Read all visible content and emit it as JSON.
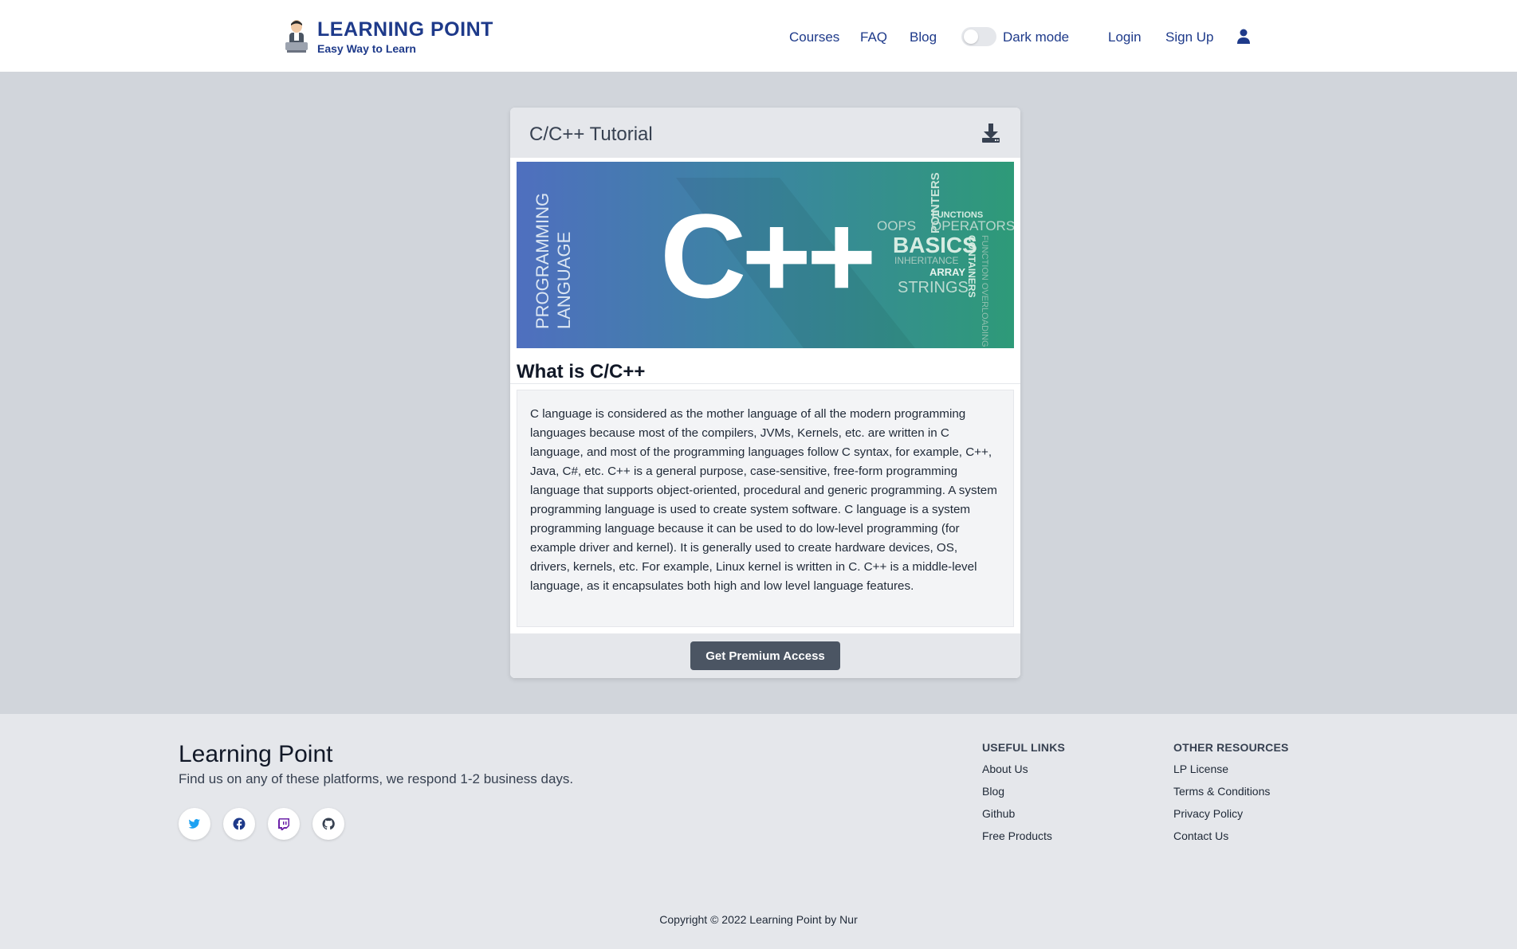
{
  "header": {
    "logo_title": "LEARNING POINT",
    "logo_subtitle": "Easy Way to Learn",
    "nav": {
      "courses": "Courses",
      "faq": "FAQ",
      "blog": "Blog",
      "dark_mode": "Dark mode",
      "login": "Login",
      "signup": "Sign Up"
    },
    "dark_mode_on": false
  },
  "card": {
    "title": "C/C++ Tutorial",
    "banner": {
      "side_text_1": "PROGRAMMING",
      "side_text_2": "LANGUAGE",
      "logo_text": "C++",
      "words": [
        "POINTERS",
        "FUNCTIONS",
        "OOPS",
        "OPERATORS",
        "BASICS",
        "CONTAINERS",
        "INHERITANCE",
        "ARRAY",
        "STRINGS",
        "FUNCTION OVERLOADING"
      ]
    },
    "section_title": "What is C/C++",
    "description": "C language is considered as the mother language of all the modern programming languages because most of the compilers, JVMs, Kernels, etc. are written in C language, and most of the programming languages follow C syntax, for example, C++, Java, C#, etc. C++ is a general purpose, case-sensitive, free-form programming language that supports object-oriented, procedural and generic programming. A system programming language is used to create system software. C language is a system programming language because it can be used to do low-level programming (for example driver and kernel). It is generally used to create hardware devices, OS, drivers, kernels, etc. For example, Linux kernel is written in C. C++ is a middle-level language, as it encapsulates both high and low level language features.",
    "premium_button": "Get Premium Access"
  },
  "footer": {
    "brand": "Learning Point",
    "tagline": "Find us on any of these platforms, we respond 1-2 business days.",
    "useful_links": {
      "title": "USEFUL LINKS",
      "items": [
        "About Us",
        "Blog",
        "Github",
        "Free Products"
      ]
    },
    "other_resources": {
      "title": "OTHER RESOURCES",
      "items": [
        "LP License",
        "Terms & Conditions",
        "Privacy Policy",
        "Contact Us"
      ]
    },
    "copyright": "Copyright © 2022 Learning Point by Nur"
  },
  "colors": {
    "brand": "#1e3a8a",
    "page_bg": "#d1d5db",
    "footer_bg": "#e5e7eb",
    "button": "#4b5563",
    "twitter": "#1da1f2",
    "facebook": "#1e3a8a",
    "twitch": "#6b21a8",
    "github": "#374151"
  }
}
